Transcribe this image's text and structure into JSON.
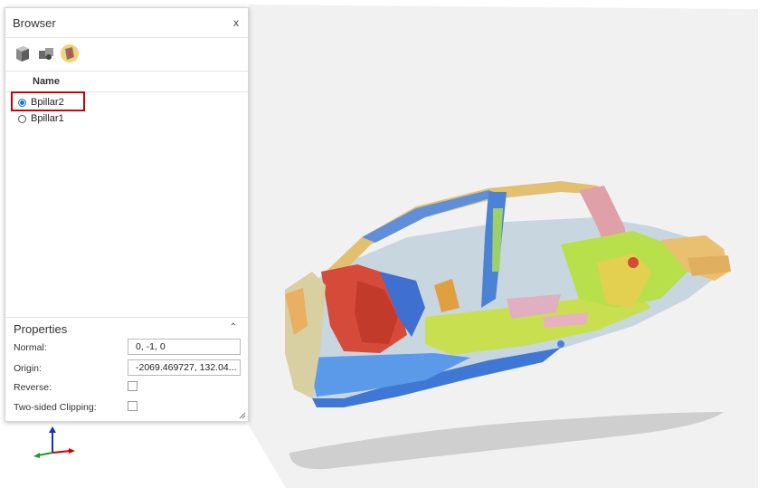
{
  "browser": {
    "title": "Browser",
    "close_label": "x",
    "toolbar": [
      {
        "icon": "cube-icon"
      },
      {
        "icon": "parts-icon"
      },
      {
        "icon": "section-cut-icon"
      }
    ],
    "column_header": "Name",
    "items": [
      {
        "label": "Bpillar2",
        "selected": true
      },
      {
        "label": "Bpillar1",
        "selected": false
      }
    ]
  },
  "properties": {
    "title": "Properties",
    "collapse_icon": "chevron-up-icon",
    "normal": {
      "label": "Normal:",
      "value": "0, -1, 0"
    },
    "origin": {
      "label": "Origin:",
      "value": "-2069.469727, 132.04..."
    },
    "reverse": {
      "label": "Reverse:",
      "checked": false
    },
    "two_sided": {
      "label": "Two-sided Clipping:",
      "checked": false
    }
  },
  "viewport": {
    "model": "car-body-in-white",
    "colors": {
      "selection_red": "#d10000",
      "radio_blue": "#1a73c8"
    }
  }
}
